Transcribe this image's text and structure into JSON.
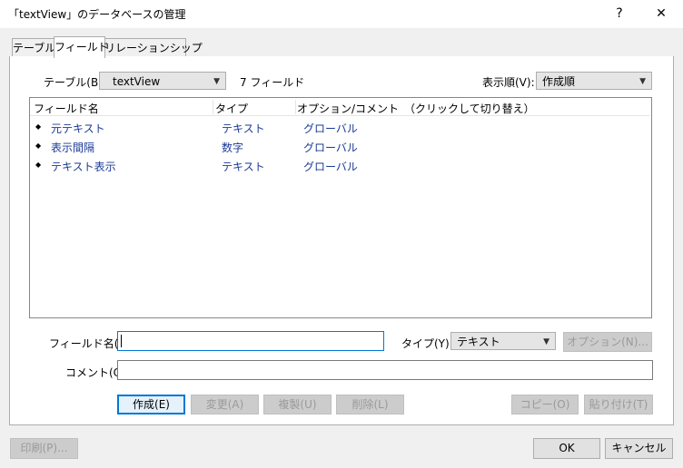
{
  "window": {
    "title": "「textView」のデータベースの管理",
    "help_label": "?",
    "close_label": "✕"
  },
  "tabs": [
    {
      "label": "テーブル",
      "active": false
    },
    {
      "label": "フィールド",
      "active": true
    },
    {
      "label": "リレーションシップ",
      "active": false
    }
  ],
  "table_selector": {
    "label": "テーブル(B):",
    "value": "textView",
    "field_count": "7 フィールド"
  },
  "sort_order": {
    "label": "表示順(V):",
    "value": "作成順"
  },
  "field_list": {
    "columns": [
      "フィールド名",
      "タイプ",
      "オプション/コメント　（クリックして切り替え）"
    ],
    "rows": [
      {
        "name": "元テキスト",
        "type": "テキスト",
        "options": "グローバル"
      },
      {
        "name": "表示間隔",
        "type": "数字",
        "options": "グローバル"
      },
      {
        "name": "テキスト表示",
        "type": "テキスト",
        "options": "グローバル"
      }
    ]
  },
  "form": {
    "field_name_label": "フィールド名(F):",
    "field_name_value": "",
    "type_label": "タイプ(Y):",
    "type_value": "テキスト",
    "options_button": "オプション(N)...",
    "comment_label": "コメント(C):",
    "comment_value": ""
  },
  "actions": {
    "create": "作成(E)",
    "change": "変更(A)",
    "duplicate": "複製(U)",
    "delete": "削除(L)",
    "copy": "コピー(O)",
    "paste": "貼り付け(T)"
  },
  "footer": {
    "print": "印刷(P)...",
    "ok": "OK",
    "cancel": "キャンセル"
  },
  "colors": {
    "accent": "#0078d7",
    "list_text": "#1a3a94"
  }
}
